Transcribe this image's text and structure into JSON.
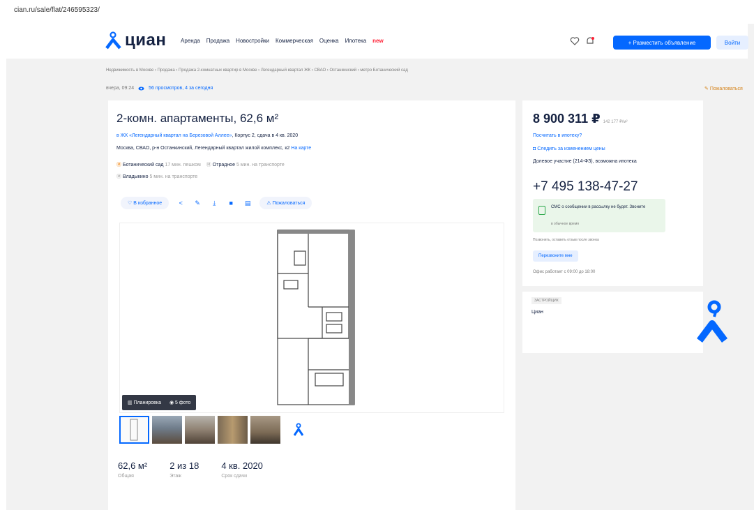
{
  "browser": {
    "url": "cian.ru/sale/flat/246595323/"
  },
  "header": {
    "logo_text": "циан",
    "nav": [
      "Аренда",
      "Продажа",
      "Новостройки",
      "Коммерческая",
      "Оценка",
      "Ипотека"
    ],
    "nav_badge": "new",
    "post_button": "+ Разместить объявление",
    "login_button": "Войти"
  },
  "breadcrumbs": "Недвижимость в Москве › Продажа › Продажа 2-комнатных квартир в Москве › Легендарный квартал ЖК › СВАО › Останкинский › метро Ботанический сад",
  "stats": {
    "date": "вчера, 09:24",
    "views": "56 просмотров, 4 за сегодня"
  },
  "complain": "Пожаловаться",
  "listing": {
    "title": "2-комн. апартаменты, 62,6 м²",
    "jk_link": "в ЖК «Легендарный квартал на Березовой Аллее»",
    "jk_rest": ", Корпус 2, сдача в 4 кв. 2020",
    "address": "Москва, СВАО, р-н Останкинский, Легендарный квартал жилой комплекс, к2",
    "map_link": "На карте",
    "metro": [
      {
        "name": "Ботанический сад",
        "time": "17 мин. пешком",
        "color": "#f07d00"
      },
      {
        "name": "Отрадное",
        "time": "5 мин. на транспорте",
        "color": "#a0a0a0"
      },
      {
        "name": "Владыкино",
        "time": "5 мин. на транспорте",
        "color": "#a0a0a0"
      }
    ],
    "fav_button": "В избранное",
    "report_button": "Пожаловаться",
    "gallery_tabs": {
      "plan": "Планировка",
      "photos": "5 фото"
    },
    "facts": [
      {
        "value": "62,6 м²",
        "label": "Общая"
      },
      {
        "value": "2 из 18",
        "label": "Этаж"
      },
      {
        "value": "4 кв. 2020",
        "label": "Срок сдачи"
      }
    ]
  },
  "sidebar": {
    "price": "8 900 311 ₽",
    "price_per_m": "142 177 ₽/м²",
    "mortgage_link": "Посчитать в ипотеку?",
    "watch_price": "Следить за изменением цены",
    "terms": "Долевое участие (214-ФЗ), возможна ипотека",
    "phone": "+7 495 138-47-27",
    "sms_text": "СМС о сообщении в рассылку не будет. Звоните",
    "sms_note": "в обычное время",
    "remind": "Позвонить, оставить отзыв после звонка",
    "callback_button": "Перезвоните мне",
    "hours": "Офис работает с 09:00 до 18:00"
  },
  "developer": {
    "badge": "ЗАСТРОЙЩИК",
    "name": "Циан"
  },
  "colors": {
    "accent": "#0468ff",
    "text": "#152242",
    "bg": "#f2f2f2",
    "alert": "#ff1f34"
  }
}
